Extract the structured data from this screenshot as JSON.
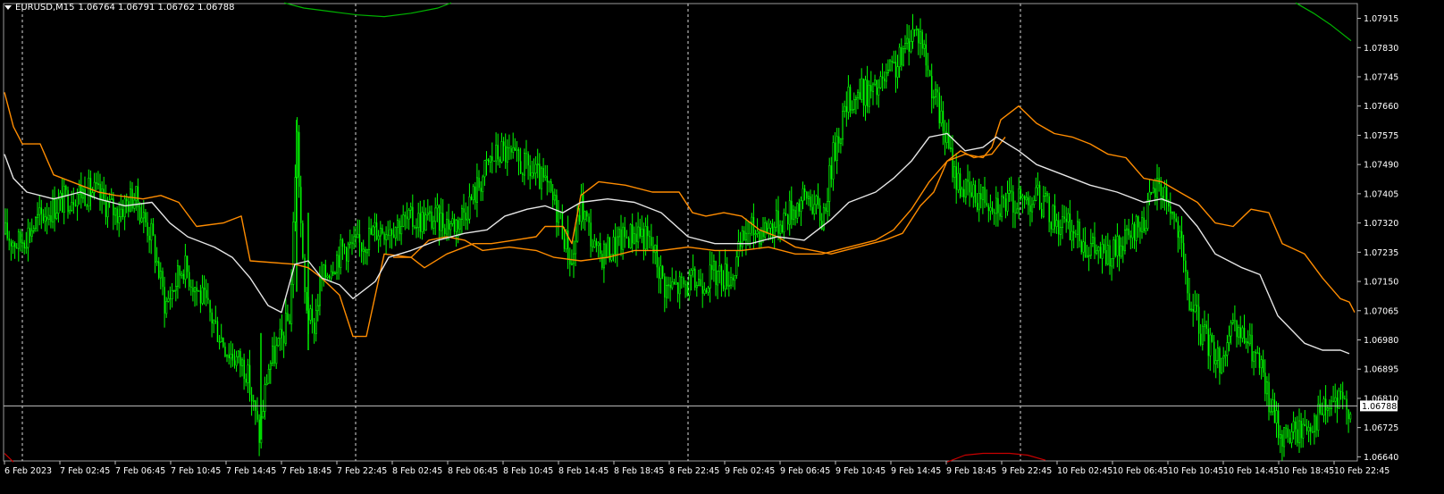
{
  "header": {
    "symbol": "EURUSD,M15",
    "ohlc": "1.06764 1.06791 1.06762 1.06788"
  },
  "current_price_label": "1.06788",
  "colors": {
    "background": "#000000",
    "candles": "#00ff00",
    "upper_band": "#ff8c00",
    "middle_line": "#e6e6e6",
    "price_line": "#c0c0c0",
    "grid": "#d8d8d8",
    "axis_text": "#ffffff",
    "green_curve": "#00b400",
    "red_curve": "#c80000"
  },
  "chart_data": {
    "type": "candlestick",
    "y_ticks": [
      "1.07915",
      "1.07830",
      "1.07745",
      "1.07660",
      "1.07575",
      "1.07490",
      "1.07405",
      "1.07320",
      "1.07235",
      "1.07150",
      "1.07065",
      "1.06980",
      "1.06895",
      "1.06810",
      "1.06725",
      "1.06640"
    ],
    "x_ticks": [
      "6 Feb 2023",
      "7 Feb 02:45",
      "7 Feb 06:45",
      "7 Feb 10:45",
      "7 Feb 14:45",
      "7 Feb 18:45",
      "7 Feb 22:45",
      "8 Feb 02:45",
      "8 Feb 06:45",
      "8 Feb 10:45",
      "8 Feb 14:45",
      "8 Feb 18:45",
      "8 Feb 22:45",
      "9 Feb 02:45",
      "9 Feb 06:45",
      "9 Feb 10:45",
      "9 Feb 14:45",
      "9 Feb 18:45",
      "9 Feb 22:45",
      "10 Feb 02:45",
      "10 Feb 06:45",
      "10 Feb 10:45",
      "10 Feb 14:45",
      "10 Feb 18:45",
      "10 Feb 22:45"
    ],
    "ylim": [
      1.0664,
      1.0794
    ],
    "current_price": 1.06788,
    "price_trend": [
      [
        0,
        1.073
      ],
      [
        20,
        1.0726
      ],
      [
        50,
        1.0735
      ],
      [
        85,
        1.0741
      ],
      [
        105,
        1.0741
      ],
      [
        130,
        1.0735
      ],
      [
        150,
        1.074
      ],
      [
        170,
        1.0728
      ],
      [
        185,
        1.0708
      ],
      [
        205,
        1.072
      ],
      [
        230,
        1.0708
      ],
      [
        255,
        1.0695
      ],
      [
        275,
        1.069
      ],
      [
        290,
        1.067
      ],
      [
        300,
        1.069
      ],
      [
        315,
        1.0698
      ],
      [
        325,
        1.0706
      ],
      [
        332,
        1.076
      ],
      [
        340,
        1.0712
      ],
      [
        350,
        1.07
      ],
      [
        358,
        1.0714
      ],
      [
        370,
        1.072
      ],
      [
        385,
        1.0725
      ],
      [
        400,
        1.0725
      ],
      [
        420,
        1.073
      ],
      [
        445,
        1.0732
      ],
      [
        470,
        1.0733
      ],
      [
        490,
        1.0733
      ],
      [
        510,
        1.0732
      ],
      [
        530,
        1.074
      ],
      [
        548,
        1.075
      ],
      [
        562,
        1.0753
      ],
      [
        575,
        1.075
      ],
      [
        590,
        1.0748
      ],
      [
        610,
        1.0743
      ],
      [
        625,
        1.0735
      ],
      [
        640,
        1.072
      ],
      [
        650,
        1.0738
      ],
      [
        668,
        1.0722
      ],
      [
        685,
        1.0725
      ],
      [
        700,
        1.0728
      ],
      [
        715,
        1.073
      ],
      [
        730,
        1.0725
      ],
      [
        745,
        1.0713
      ],
      [
        770,
        1.0714
      ],
      [
        800,
        1.0717
      ],
      [
        820,
        1.0717
      ],
      [
        835,
        1.073
      ],
      [
        850,
        1.073
      ],
      [
        870,
        1.0732
      ],
      [
        890,
        1.0737
      ],
      [
        905,
        1.074
      ],
      [
        920,
        1.0733
      ],
      [
        935,
        1.0755
      ],
      [
        950,
        1.0768
      ],
      [
        965,
        1.077
      ],
      [
        980,
        1.077
      ],
      [
        995,
        1.0775
      ],
      [
        1010,
        1.078
      ],
      [
        1020,
        1.0788
      ],
      [
        1030,
        1.0787
      ],
      [
        1040,
        1.0775
      ],
      [
        1050,
        1.0765
      ],
      [
        1060,
        1.0755
      ],
      [
        1070,
        1.0745
      ],
      [
        1085,
        1.074
      ],
      [
        1100,
        1.074
      ],
      [
        1120,
        1.0738
      ],
      [
        1140,
        1.0738
      ],
      [
        1160,
        1.074
      ],
      [
        1180,
        1.0733
      ],
      [
        1200,
        1.073
      ],
      [
        1220,
        1.0725
      ],
      [
        1240,
        1.0722
      ],
      [
        1260,
        1.0726
      ],
      [
        1280,
        1.0733
      ],
      [
        1295,
        1.0743
      ],
      [
        1305,
        1.074
      ],
      [
        1318,
        1.073
      ],
      [
        1330,
        1.071
      ],
      [
        1345,
        1.07
      ],
      [
        1365,
        1.0692
      ],
      [
        1380,
        1.07
      ],
      [
        1395,
        1.0698
      ],
      [
        1410,
        1.069
      ],
      [
        1420,
        1.068
      ],
      [
        1435,
        1.067
      ],
      [
        1455,
        1.0672
      ],
      [
        1475,
        1.0676
      ],
      [
        1495,
        1.068
      ],
      [
        1510,
        1.0679
      ]
    ],
    "upper_band": [
      [
        5,
        1.077
      ],
      [
        15,
        1.076
      ],
      [
        25,
        1.0755
      ],
      [
        45,
        1.0755
      ],
      [
        60,
        1.0746
      ],
      [
        90,
        1.0743
      ],
      [
        110,
        1.0741
      ],
      [
        130,
        1.074
      ],
      [
        160,
        1.0739
      ],
      [
        180,
        1.074
      ],
      [
        200,
        1.0738
      ],
      [
        220,
        1.0731
      ],
      [
        250,
        1.0732
      ],
      [
        270,
        1.0734
      ],
      [
        280,
        1.0721
      ],
      [
        330,
        1.072
      ],
      [
        345,
        1.0719
      ],
      [
        360,
        1.0716
      ],
      [
        380,
        1.0711
      ],
      [
        395,
        1.0699
      ],
      [
        410,
        1.0699
      ],
      [
        430,
        1.0723
      ],
      [
        460,
        1.0722
      ],
      [
        475,
        1.0719
      ],
      [
        500,
        1.0723
      ],
      [
        530,
        1.0726
      ],
      [
        550,
        1.0726
      ],
      [
        575,
        1.0727
      ],
      [
        600,
        1.0728
      ],
      [
        610,
        1.0731
      ],
      [
        630,
        1.0731
      ],
      [
        640,
        1.0726
      ],
      [
        650,
        1.074
      ],
      [
        670,
        1.0744
      ],
      [
        700,
        1.0743
      ],
      [
        730,
        1.0741
      ],
      [
        760,
        1.0741
      ],
      [
        775,
        1.0735
      ],
      [
        790,
        1.0734
      ],
      [
        810,
        1.0735
      ],
      [
        830,
        1.0734
      ],
      [
        850,
        1.073
      ],
      [
        870,
        1.0728
      ],
      [
        890,
        1.0725
      ],
      [
        930,
        1.0723
      ],
      [
        960,
        1.0725
      ],
      [
        990,
        1.0727
      ],
      [
        1010,
        1.0729
      ],
      [
        1030,
        1.0737
      ],
      [
        1045,
        1.0741
      ],
      [
        1060,
        1.075
      ],
      [
        1080,
        1.0752
      ],
      [
        1100,
        1.0751
      ],
      [
        1110,
        1.0754
      ],
      [
        1120,
        1.0762
      ],
      [
        1140,
        1.0766
      ],
      [
        1160,
        1.0761
      ],
      [
        1180,
        1.0758
      ],
      [
        1200,
        1.0757
      ],
      [
        1220,
        1.0755
      ],
      [
        1240,
        1.0752
      ],
      [
        1260,
        1.0751
      ],
      [
        1280,
        1.0745
      ],
      [
        1300,
        1.0744
      ],
      [
        1320,
        1.0741
      ],
      [
        1340,
        1.0738
      ],
      [
        1360,
        1.0732
      ],
      [
        1380,
        1.0731
      ],
      [
        1400,
        1.0736
      ],
      [
        1420,
        1.0735
      ],
      [
        1435,
        1.0726
      ],
      [
        1460,
        1.0723
      ],
      [
        1480,
        1.0716
      ],
      [
        1500,
        1.071
      ],
      [
        1510,
        1.0709
      ],
      [
        1516,
        1.0706
      ]
    ],
    "middle_line": [
      [
        5,
        1.0752
      ],
      [
        15,
        1.0745
      ],
      [
        30,
        1.0741
      ],
      [
        60,
        1.0739
      ],
      [
        90,
        1.0741
      ],
      [
        110,
        1.0739
      ],
      [
        140,
        1.0737
      ],
      [
        170,
        1.0738
      ],
      [
        190,
        1.0732
      ],
      [
        210,
        1.0728
      ],
      [
        240,
        1.0725
      ],
      [
        260,
        1.0722
      ],
      [
        280,
        1.0716
      ],
      [
        300,
        1.0708
      ],
      [
        315,
        1.0706
      ],
      [
        330,
        1.072
      ],
      [
        345,
        1.0721
      ],
      [
        360,
        1.0716
      ],
      [
        380,
        1.0714
      ],
      [
        395,
        1.071
      ],
      [
        420,
        1.0715
      ],
      [
        435,
        1.0722
      ],
      [
        460,
        1.0724
      ],
      [
        490,
        1.0727
      ],
      [
        520,
        1.0729
      ],
      [
        545,
        1.073
      ],
      [
        565,
        1.0734
      ],
      [
        590,
        1.0736
      ],
      [
        610,
        1.0737
      ],
      [
        630,
        1.0735
      ],
      [
        650,
        1.0738
      ],
      [
        680,
        1.0739
      ],
      [
        710,
        1.0738
      ],
      [
        740,
        1.0735
      ],
      [
        770,
        1.0728
      ],
      [
        800,
        1.0726
      ],
      [
        840,
        1.0726
      ],
      [
        870,
        1.0728
      ],
      [
        900,
        1.0727
      ],
      [
        930,
        1.0733
      ],
      [
        950,
        1.0738
      ],
      [
        980,
        1.0741
      ],
      [
        1000,
        1.0745
      ],
      [
        1020,
        1.075
      ],
      [
        1040,
        1.0757
      ],
      [
        1060,
        1.0758
      ],
      [
        1080,
        1.0753
      ],
      [
        1100,
        1.0754
      ],
      [
        1115,
        1.0757
      ],
      [
        1140,
        1.0753
      ],
      [
        1160,
        1.0749
      ],
      [
        1190,
        1.0746
      ],
      [
        1220,
        1.0743
      ],
      [
        1250,
        1.0741
      ],
      [
        1280,
        1.0738
      ],
      [
        1300,
        1.0739
      ],
      [
        1320,
        1.0737
      ],
      [
        1340,
        1.0731
      ],
      [
        1360,
        1.0723
      ],
      [
        1390,
        1.0719
      ],
      [
        1410,
        1.0717
      ],
      [
        1430,
        1.0705
      ],
      [
        1460,
        1.0697
      ],
      [
        1480,
        1.0695
      ],
      [
        1500,
        1.0695
      ],
      [
        1510,
        1.0694
      ]
    ],
    "lower_band": [
      [
        440,
        1.0722
      ],
      [
        460,
        1.0722
      ],
      [
        480,
        1.0727
      ],
      [
        500,
        1.0728
      ],
      [
        520,
        1.0727
      ],
      [
        540,
        1.0724
      ],
      [
        570,
        1.0725
      ],
      [
        600,
        1.0724
      ],
      [
        620,
        1.0722
      ],
      [
        650,
        1.0721
      ],
      [
        680,
        1.0722
      ],
      [
        710,
        1.0724
      ],
      [
        740,
        1.0724
      ],
      [
        770,
        1.0725
      ],
      [
        800,
        1.0724
      ],
      [
        830,
        1.0724
      ],
      [
        860,
        1.0725
      ],
      [
        890,
        1.0723
      ],
      [
        920,
        1.0723
      ],
      [
        950,
        1.0725
      ],
      [
        980,
        1.0727
      ],
      [
        1000,
        1.073
      ],
      [
        1020,
        1.0736
      ],
      [
        1040,
        1.0744
      ],
      [
        1060,
        1.075
      ],
      [
        1075,
        1.0753
      ],
      [
        1090,
        1.0751
      ],
      [
        1110,
        1.0752
      ],
      [
        1125,
        1.0757
      ]
    ],
    "green_curve": [
      [
        318,
        1.0796
      ],
      [
        340,
        1.07945
      ],
      [
        370,
        1.07935
      ],
      [
        400,
        1.07925
      ],
      [
        430,
        1.0792
      ],
      [
        460,
        1.0793
      ],
      [
        490,
        1.07945
      ],
      [
        505,
        1.0796
      ]
    ],
    "green_curve_right": [
      [
        1450,
        1.0796
      ],
      [
        1470,
        1.0793
      ],
      [
        1490,
        1.07895
      ],
      [
        1512,
        1.0785
      ]
    ],
    "red_curve": [
      [
        1060,
        1.06625
      ],
      [
        1080,
        1.06645
      ],
      [
        1100,
        1.0665
      ],
      [
        1130,
        1.0665
      ],
      [
        1150,
        1.06645
      ],
      [
        1170,
        1.0663
      ]
    ],
    "red_curve_left": [
      [
        5,
        1.0665
      ],
      [
        15,
        1.06625
      ]
    ],
    "vertical_grid_at": [
      25,
      398,
      770,
      1142
    ]
  }
}
